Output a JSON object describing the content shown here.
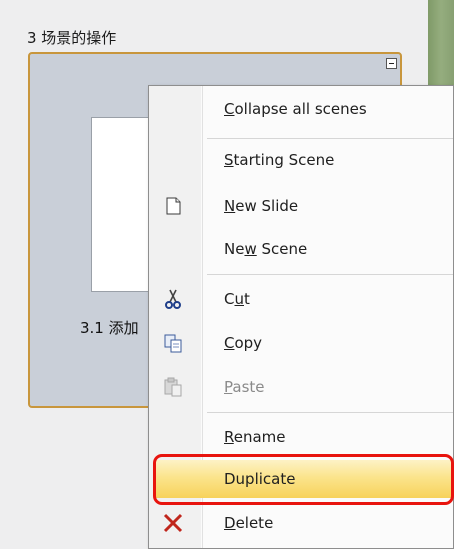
{
  "scene": {
    "header": "3 场景的操作",
    "thumbnail_label": "3.1 添加"
  },
  "context_menu": {
    "items": [
      {
        "label": "Collapse all scenes",
        "mnemonic": "C",
        "icon": ""
      },
      {
        "label": "Starting Scene",
        "mnemonic": "S",
        "icon": ""
      },
      {
        "label": "New Slide",
        "mnemonic": "N",
        "icon": "new-slide-icon"
      },
      {
        "label": "New Scene",
        "mnemonic": "w",
        "icon": ""
      },
      {
        "label": "Cut",
        "mnemonic": "u",
        "icon": "scissors-icon"
      },
      {
        "label": "Copy",
        "mnemonic": "C",
        "icon": "copy-icon"
      },
      {
        "label": "Paste",
        "mnemonic": "P",
        "icon": "paste-icon",
        "disabled": true
      },
      {
        "label": "Rename",
        "mnemonic": "R",
        "icon": ""
      },
      {
        "label": "Duplicate",
        "mnemonic": "",
        "icon": "",
        "highlighted": true
      },
      {
        "label": "Delete",
        "mnemonic": "D",
        "icon": "delete-x-icon"
      }
    ]
  },
  "colors": {
    "highlight_border": "#e8140e",
    "group_border": "#c8963c",
    "hover_fill": "#fbe48c"
  }
}
